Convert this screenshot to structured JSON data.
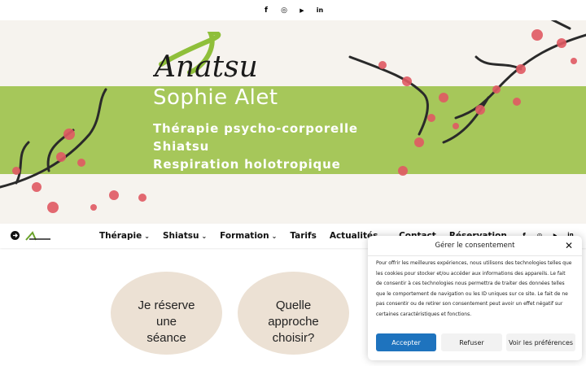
{
  "topbar": {
    "icons": [
      "facebook-icon",
      "instagram-icon",
      "youtube-icon",
      "linkedin-icon"
    ],
    "glyphs": {
      "facebook": "f",
      "instagram": "◎",
      "youtube": "▶",
      "linkedin": "in"
    }
  },
  "banner": {
    "logo_text": "Anatsu",
    "name": "Sophie Alet",
    "lines": [
      "Thérapie psycho-corporelle",
      "Shiatsu",
      "Respiration holotropique"
    ],
    "colors": {
      "green": "#a6c75a",
      "blossom": "#e05a63",
      "branch": "#2a2a2a"
    }
  },
  "nav": {
    "items": [
      {
        "label": "Thérapie",
        "chevron": "⌄"
      },
      {
        "label": "Shiatsu",
        "chevron": "⌄"
      },
      {
        "label": "Formation",
        "chevron": "⌄"
      },
      {
        "label": "Tarifs",
        "chevron": ""
      },
      {
        "label": "Actualités",
        "chevron": "⌄"
      },
      {
        "label": "Contact",
        "chevron": ""
      },
      {
        "label": "Réservation",
        "chevron": ""
      }
    ],
    "social_glyphs": {
      "facebook": "f",
      "instagram": "◎",
      "youtube": "▶",
      "linkedin": "in"
    }
  },
  "cards": [
    {
      "lines": [
        "Je réserve",
        "une",
        "séance"
      ]
    },
    {
      "lines": [
        "Quelle",
        "approche",
        "choisir?"
      ]
    }
  ],
  "cookie": {
    "title": "Gérer le consentement",
    "close": "✕",
    "body_lines": [
      "Pour offrir les meilleures expériences, nous utilisons des technologies telles que",
      "les cookies pour stocker et/ou accéder aux informations des appareils. Le fait",
      "de consentir à ces technologies nous permettra de traiter des données telles",
      "que le comportement de navigation ou les ID uniques sur ce site. Le fait de ne",
      "pas consentir ou de retirer son consentement peut avoir un effet négatif sur",
      "certaines caractéristiques et fonctions."
    ],
    "accept": "Accepter",
    "refuse": "Refuser",
    "prefs": "Voir les préférences",
    "accent": "#1e73be"
  }
}
